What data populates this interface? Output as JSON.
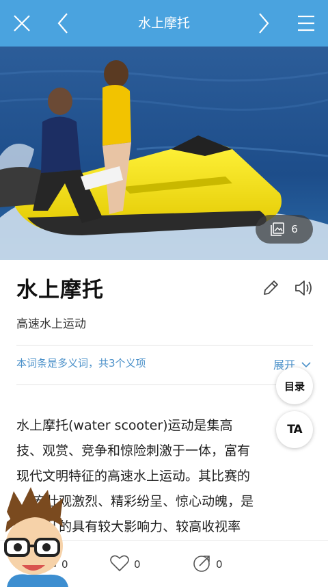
{
  "header": {
    "title": "水上摩托",
    "close_icon": "close-icon",
    "back_icon": "chevron-left-icon",
    "forward_icon": "chevron-right-icon",
    "menu_icon": "menu-icon"
  },
  "hero": {
    "photo_count": "6"
  },
  "entry": {
    "title": "水上摩托",
    "subtitle": "高速水上运动",
    "polysemy_note": "本词条是多义词，共3个义项",
    "expand_label": "展开"
  },
  "body": {
    "lines": [
      "水上摩托(water scooter)运动是集高",
      "技、观赏、竞争和惊险刺激于一体，富有",
      "现代文明特征的高速水上运动。其比赛的",
      "    宏壮观激烈、精彩纷呈、惊心动魄，是",
      "    公认的具有较大影响力、较高收视率"
    ]
  },
  "fab": {
    "toc_label": "目录",
    "ta_label": "TA"
  },
  "bottom": {
    "comments": "0",
    "likes": "0",
    "shares": "0"
  },
  "colors": {
    "accent": "#4aa3df",
    "link": "#4a90c9"
  }
}
